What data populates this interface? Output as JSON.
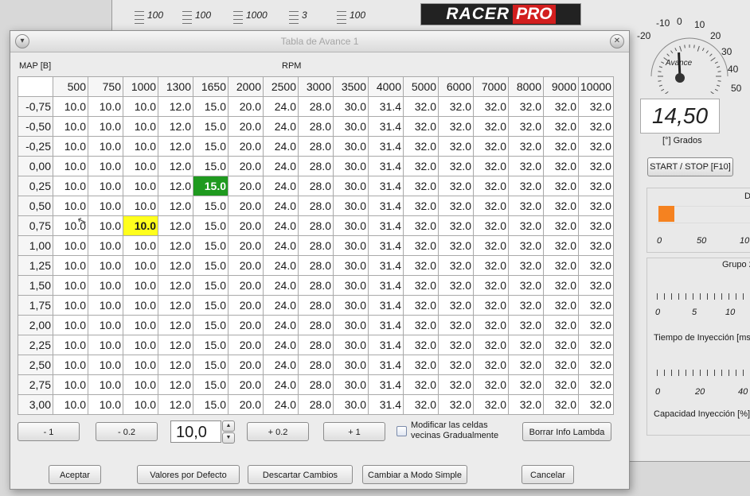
{
  "background_app": {
    "top_sliders": [
      "100",
      "100",
      "1000",
      "3",
      "100"
    ],
    "logo": {
      "part1": "RACER",
      "part2": "PRO"
    },
    "gauge": {
      "title": "Avance",
      "scale_labels": [
        "-20",
        "-10",
        "0",
        "10",
        "20",
        "30",
        "40",
        "50"
      ],
      "value": "14,50",
      "unit": "[°] Grados",
      "needle_fraction": 0.49
    },
    "start_button": "START / STOP [F10]",
    "panel1": {
      "title": "D",
      "fill_fraction": 0.15,
      "scale": [
        "0",
        "50",
        "10"
      ]
    },
    "panel2": {
      "title": "Grupo 2",
      "scale1": [
        "0",
        "5",
        "10"
      ],
      "caption1": "Tiempo de  Inyección [ms",
      "scale2": [
        "0",
        "20",
        "40"
      ],
      "caption2": "Capacidad Inyección [%]"
    }
  },
  "dialog": {
    "title": "Tabla de Avance 1",
    "map_label": "MAP [B]",
    "rpm_label": "RPM",
    "rpm_columns": [
      "500",
      "750",
      "1000",
      "1300",
      "1650",
      "2000",
      "2500",
      "3000",
      "3500",
      "4000",
      "5000",
      "6000",
      "7000",
      "8000",
      "9000",
      "10000"
    ],
    "map_rows": [
      "-0,75",
      "-0,50",
      "-0,25",
      "0,00",
      "0,25",
      "0,50",
      "0,75",
      "1,00",
      "1,25",
      "1,50",
      "1,75",
      "2,00",
      "2,25",
      "2,50",
      "2,75",
      "3,00"
    ],
    "row_values": [
      "10.0",
      "10.0",
      "10.0",
      "12.0",
      "15.0",
      "20.0",
      "24.0",
      "28.0",
      "30.0",
      "31.4",
      "32.0",
      "32.0",
      "32.0",
      "32.0",
      "32.0",
      "32.0"
    ],
    "highlight_green": {
      "row": 4,
      "col": 4
    },
    "highlight_yellow": {
      "row": 6,
      "col": 2
    },
    "controls": {
      "minus1": "- 1",
      "minus02": "- 0.2",
      "value": "10,0",
      "plus02": "+ 0.2",
      "plus1": "+ 1",
      "gradual_label": "Modificar las celdas vecinas Gradualmente",
      "gradual_checked": false,
      "clear_lambda": "Borrar Info Lambda"
    },
    "footer": {
      "accept": "Aceptar",
      "defaults": "Valores por Defecto",
      "discard": "Descartar Cambios",
      "simple_mode": "Cambiar a Modo Simple",
      "cancel": "Cancelar"
    }
  }
}
